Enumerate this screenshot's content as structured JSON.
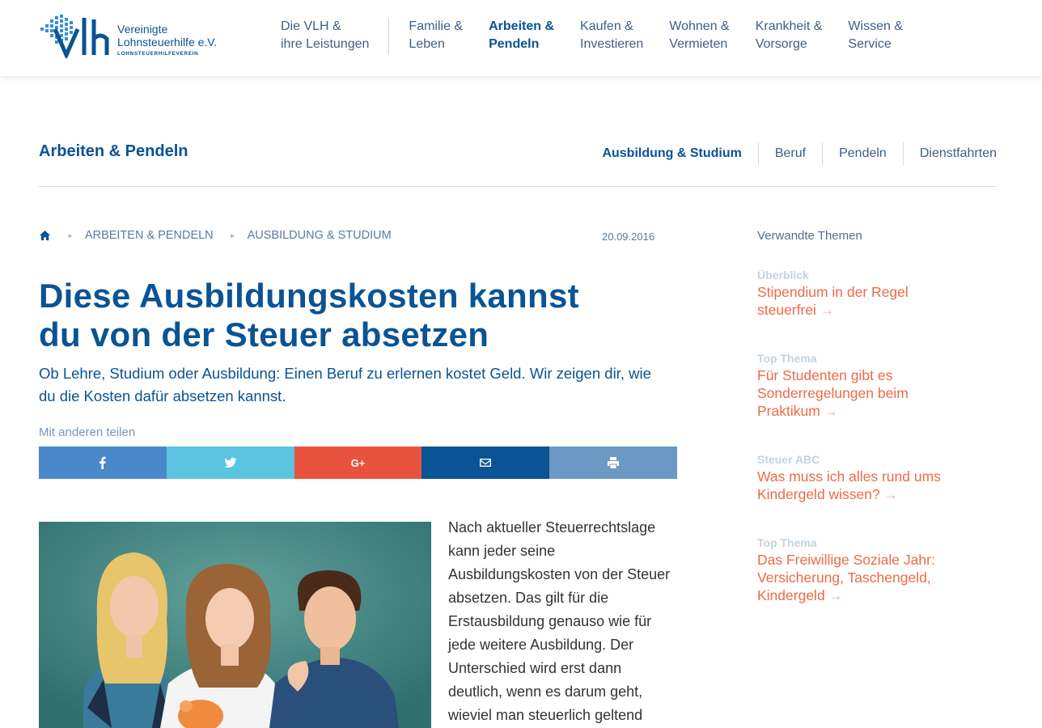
{
  "brand": {
    "name_line1": "Vereinigte",
    "name_line2": "Lohnsteuerhilfe e.V.",
    "subtitle": "LOHNSTEUERHILFEVEREIN",
    "mark_text": "VLh",
    "colors": {
      "primary": "#0a5394",
      "accent": "#ee6a46"
    }
  },
  "mainnav": [
    {
      "line1": "Die VLH &",
      "line2": "ihre Leistungen"
    },
    {
      "line1": "Familie &",
      "line2": "Leben"
    },
    {
      "line1": "Arbeiten &",
      "line2": "Pendeln"
    },
    {
      "line1": "Kaufen &",
      "line2": "Investieren"
    },
    {
      "line1": "Wohnen &",
      "line2": "Vermieten"
    },
    {
      "line1": "Krankheit &",
      "line2": "Vorsorge"
    },
    {
      "line1": "Wissen &",
      "line2": "Service"
    }
  ],
  "section": {
    "title": "Arbeiten & Pendeln",
    "subnav": [
      "Ausbildung & Studium",
      "Beruf",
      "Pendeln",
      "Dienstfahrten"
    ]
  },
  "breadcrumb": {
    "home_icon": "home-icon",
    "items": [
      "ARBEITEN & PENDELN",
      "AUSBILDUNG & STUDIUM"
    ]
  },
  "article": {
    "date": "20.09.2016",
    "headline_line1": "Diese Ausbildungskosten kannst",
    "headline_line2": "du von der Steuer absetzen",
    "teaser": "Ob Lehre, Studium oder Ausbildung: Einen Beruf zu erlernen kostet Geld. Wir zeigen dir, wie du die Kosten dafür absetzen kannst.",
    "share_label": "Mit anderen teilen",
    "share_buttons": [
      "facebook-icon",
      "twitter-icon",
      "google-plus-icon",
      "email-icon",
      "print-icon"
    ],
    "google_plus_text": "G+",
    "body": "Nach aktueller Steuerrechtslage kann jeder seine Ausbildungskosten von der Steuer absetzen. Das gilt für die Erstausbildung genauso wie für jede weitere Ausbildung. Der Unterschied wird erst dann deutlich, wenn es darum geht, wieviel man steuerlich geltend"
  },
  "sidebar": {
    "title": "Verwandte Themen",
    "items": [
      {
        "category": "Überblick",
        "title": "Stipendium in der Regel steuerfrei"
      },
      {
        "category": "Top Thema",
        "title": "Für Studenten gibt es Sonderregelungen beim Praktikum"
      },
      {
        "category": "Steuer ABC",
        "title": "Was muss ich alles rund ums Kindergeld wissen?"
      },
      {
        "category": "Top Thema",
        "title": "Das Freiwillige Soziale Jahr: Versicherung, Taschengeld, Kindergeld"
      }
    ],
    "arrow": "→"
  }
}
